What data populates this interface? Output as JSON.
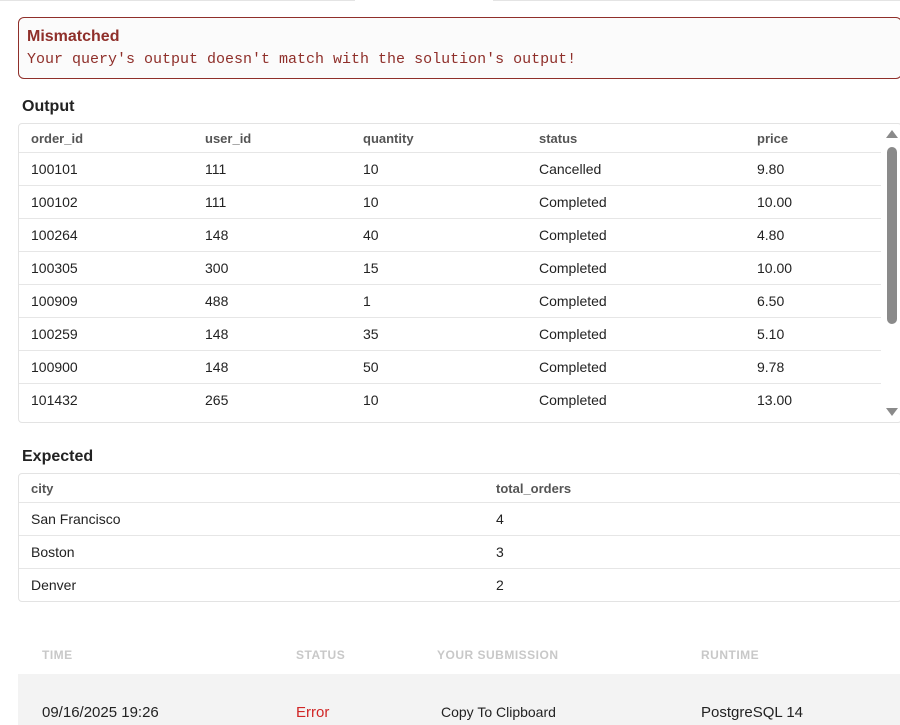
{
  "alert": {
    "title": "Mismatched",
    "message": "Your query's output doesn't match with the solution's output!",
    "color": "#8f2f2a"
  },
  "output": {
    "label": "Output",
    "columns": [
      "order_id",
      "user_id",
      "quantity",
      "status",
      "price"
    ],
    "rows": [
      [
        "100101",
        "111",
        "10",
        "Cancelled",
        "9.80"
      ],
      [
        "100102",
        "111",
        "10",
        "Completed",
        "10.00"
      ],
      [
        "100264",
        "148",
        "40",
        "Completed",
        "4.80"
      ],
      [
        "100305",
        "300",
        "15",
        "Completed",
        "10.00"
      ],
      [
        "100909",
        "488",
        "1",
        "Completed",
        "6.50"
      ],
      [
        "100259",
        "148",
        "35",
        "Completed",
        "5.10"
      ],
      [
        "100900",
        "148",
        "50",
        "Completed",
        "9.78"
      ],
      [
        "101432",
        "265",
        "10",
        "Completed",
        "13.00"
      ]
    ]
  },
  "expected": {
    "label": "Expected",
    "columns": [
      "city",
      "total_orders"
    ],
    "rows": [
      [
        "San Francisco",
        "4"
      ],
      [
        "Boston",
        "3"
      ],
      [
        "Denver",
        "2"
      ]
    ]
  },
  "submissions": {
    "headers": [
      "TIME",
      "STATUS",
      "YOUR SUBMISSION",
      "RUNTIME"
    ],
    "rows": [
      {
        "time": "09/16/2025 19:26",
        "status": "Error",
        "submission": "Copy To Clipboard",
        "runtime": "PostgreSQL 14"
      }
    ],
    "error_color": "#d02626"
  }
}
